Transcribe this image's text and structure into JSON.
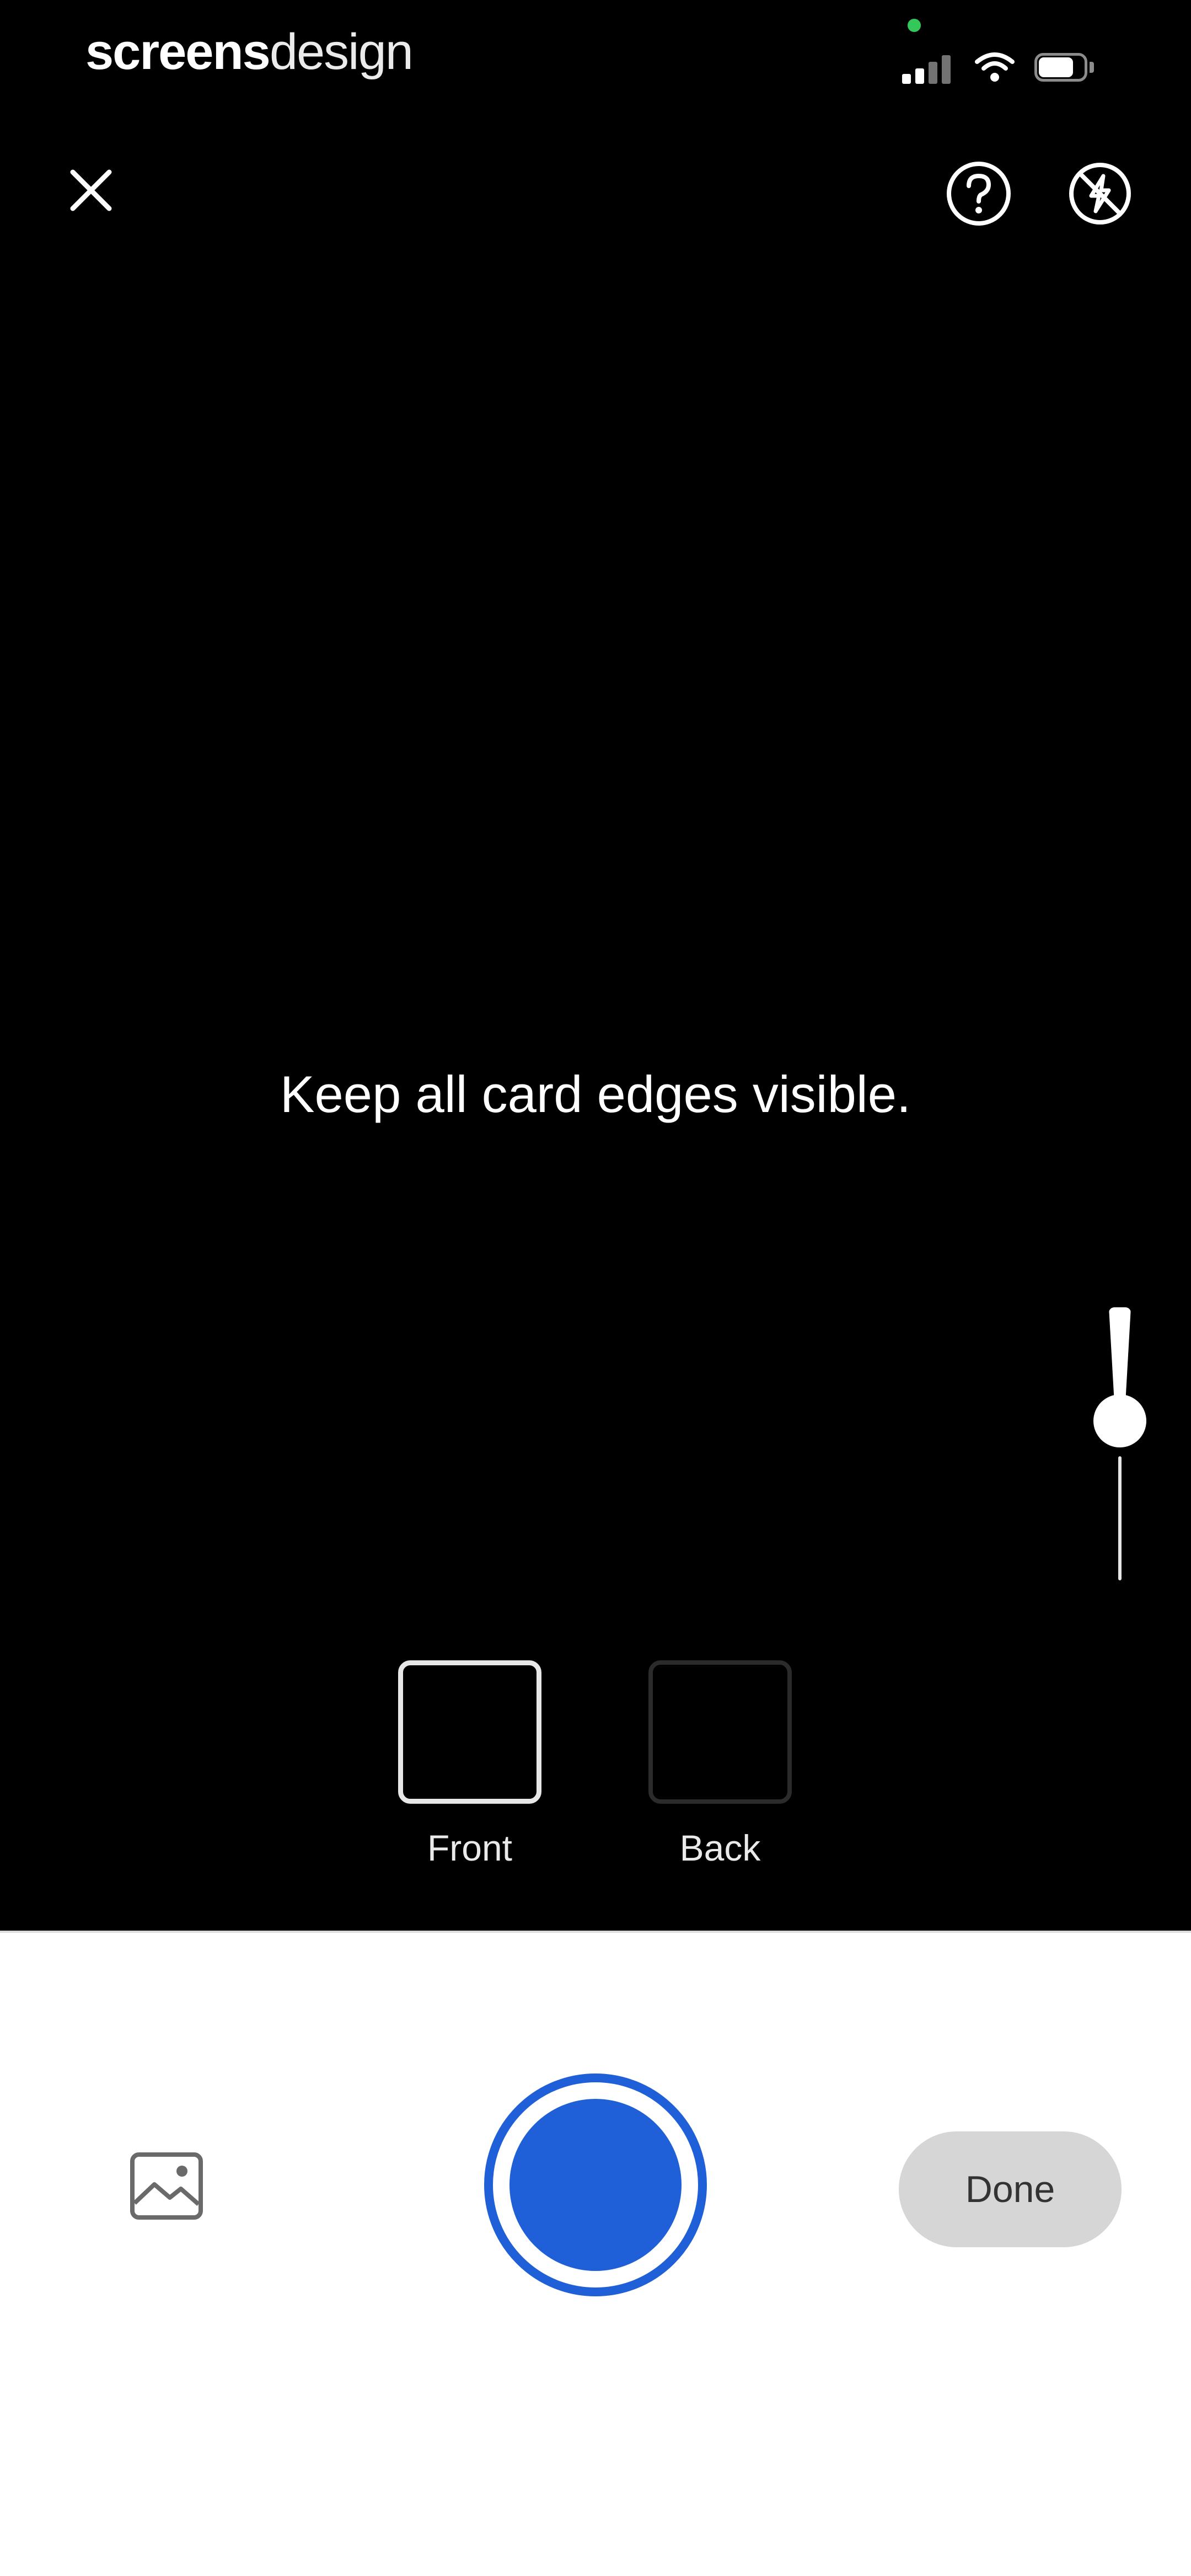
{
  "status_bar": {
    "brand_bold": "screens",
    "brand_light": "design",
    "recording_dot_color": "#34c759",
    "battery_level": 0.78,
    "icons": [
      "signal-icon",
      "wifi-icon",
      "battery-icon"
    ]
  },
  "top_controls": {
    "close_icon": "close-icon",
    "help_icon": "help-icon",
    "flash_icon": "flash-off-icon"
  },
  "instruction": "Keep all card edges visible.",
  "zoom": {
    "level": 0.6
  },
  "capture_slots": [
    {
      "label": "Front",
      "active": true
    },
    {
      "label": "Back",
      "active": false
    }
  ],
  "bottom_bar": {
    "gallery_icon": "image-icon",
    "shutter_color": "#1f5fd8",
    "done_label": "Done",
    "done_bg": "#d6d6d6"
  }
}
